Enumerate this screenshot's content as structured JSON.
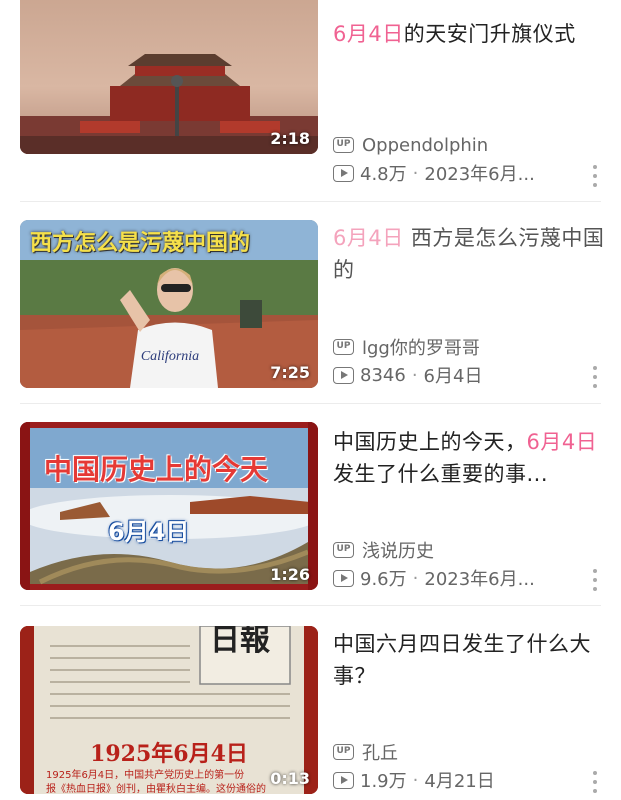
{
  "videos": [
    {
      "title_highlight": "6月4日",
      "title_rest": "的天安门升旗仪式",
      "title_tail": "",
      "uploader": "Oppendolphin",
      "views": "4.8万",
      "date": "2023年6月...",
      "duration": "2:18",
      "thumb_text": "",
      "thumb_icon": "tiananmen-gate"
    },
    {
      "title_highlight": "6月4日",
      "title_rest": " 西方是怎么污蔑中国的",
      "title_tail": "",
      "uploader": "lgg你的罗哥哥",
      "views": "8346",
      "date": "6月4日",
      "duration": "7:25",
      "thumb_text": "西方怎么是污蔑中国的",
      "thumb_icon": "woman-with-sunglasses"
    },
    {
      "title_prefix": "中国历史上的今天，",
      "title_highlight": "6月4日",
      "title_rest": "发生了什么重要的事...",
      "uploader": "浅说历史",
      "views": "9.6万",
      "date": "2023年6月...",
      "duration": "1:26",
      "thumb_text": "中国历史上的今天",
      "thumb_text2": "6月4日",
      "thumb_icon": "great-wall"
    },
    {
      "title_rest": "中国六月四日发生了什么大事？",
      "uploader": "孔丘",
      "views": "1.9万",
      "date": "4月21日",
      "duration": "0:13",
      "thumb_text": "1925年6月4日",
      "thumb_text2": "日報",
      "thumb_caption": "1925年6月4日，中国共产党历史上的第一份",
      "thumb_caption2": "报《热血日报》创刊，由瞿秋白主编。这份通俗的",
      "thumb_icon": "old-newspaper"
    }
  ],
  "labels": {
    "up_badge": "UP",
    "separator": "·"
  },
  "colors": {
    "highlight": "#f06292"
  }
}
